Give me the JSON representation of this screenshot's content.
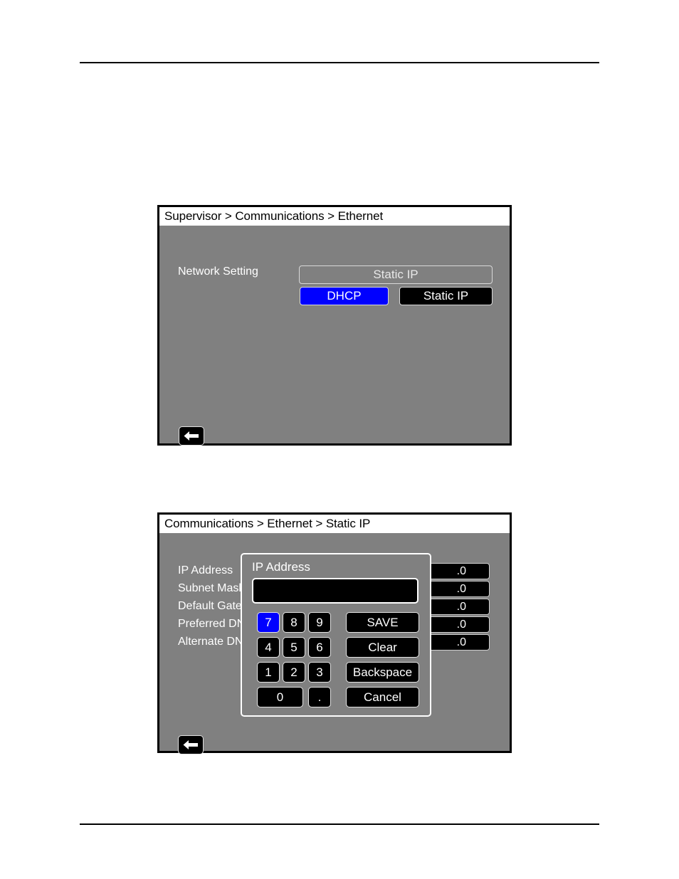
{
  "document": {
    "rules": {
      "top": "horizontal-rule",
      "bottom": "horizontal-rule"
    }
  },
  "panel_ethernet": {
    "title": "Supervisor > Communications > Ethernet",
    "setting_label": "Network Setting",
    "setting_value": "Static IP",
    "options": [
      {
        "label": "DHCP",
        "state": "selected",
        "color": "#0000FF"
      },
      {
        "label": "Static IP",
        "state": "normal",
        "color": "#000000"
      }
    ],
    "back_button": "back-arrow"
  },
  "panel_staticip": {
    "title": "Communications > Ethernet > Static IP",
    "rows": [
      {
        "label": "IP Address",
        "value": ".0"
      },
      {
        "label": "Subnet Mask",
        "value": ".0"
      },
      {
        "label": "Default Gateway",
        "value": ".0"
      },
      {
        "label": "Preferred DNS",
        "value": ".0"
      },
      {
        "label": "Alternate DNS",
        "value": ".0"
      }
    ],
    "back_button": "back-arrow",
    "keypad": {
      "title": "IP Address",
      "input_value": "",
      "input_placeholder": "",
      "keys": [
        {
          "label": "7",
          "state": "selected"
        },
        {
          "label": "8",
          "state": "normal"
        },
        {
          "label": "9",
          "state": "normal"
        },
        {
          "label": "4",
          "state": "normal"
        },
        {
          "label": "5",
          "state": "normal"
        },
        {
          "label": "6",
          "state": "normal"
        },
        {
          "label": "1",
          "state": "normal"
        },
        {
          "label": "2",
          "state": "normal"
        },
        {
          "label": "3",
          "state": "normal"
        },
        {
          "label": "0",
          "state": "normal"
        },
        {
          "label": ".",
          "state": "normal"
        }
      ],
      "actions": [
        {
          "label": "SAVE"
        },
        {
          "label": "Clear"
        },
        {
          "label": "Backspace"
        },
        {
          "label": "Cancel"
        }
      ]
    }
  },
  "colors": {
    "panel_background": "#808080",
    "titlebar_background": "#FFFFFF",
    "field_background": "#000000",
    "accent_selected": "#0000FF",
    "text_light": "#FFFFFF",
    "text_dark": "#000000"
  }
}
